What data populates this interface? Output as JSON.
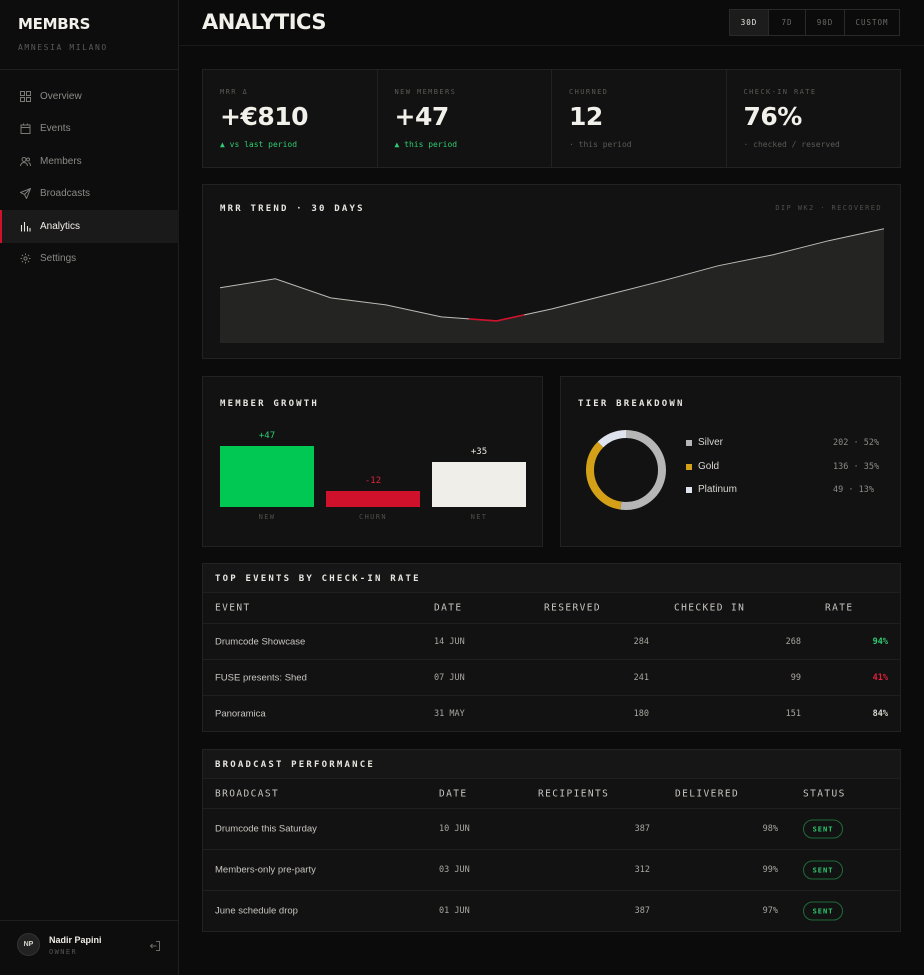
{
  "brand": {
    "name": "MEMBRS",
    "venue": "AMNESIA MILANO"
  },
  "nav": [
    {
      "label": "Overview",
      "icon": "grid-icon"
    },
    {
      "label": "Events",
      "icon": "calendar-icon"
    },
    {
      "label": "Members",
      "icon": "users-icon"
    },
    {
      "label": "Broadcasts",
      "icon": "send-icon"
    },
    {
      "label": "Analytics",
      "icon": "bar-chart-icon",
      "active": true
    },
    {
      "label": "Settings",
      "icon": "gear-icon"
    }
  ],
  "user": {
    "initials": "NP",
    "name": "Nadir Papini",
    "role": "OWNER"
  },
  "header": {
    "title": "ANALYTICS",
    "ranges": [
      "30D",
      "7D",
      "90D",
      "CUSTOM"
    ],
    "selected_range": "30D"
  },
  "kpis": [
    {
      "label": "MRR Δ",
      "value": "+€810",
      "sub": "▲ vs last period",
      "positive": true
    },
    {
      "label": "NEW MEMBERS",
      "value": "+47",
      "sub": "▲ this period",
      "positive": true
    },
    {
      "label": "CHURNED",
      "value": "12",
      "sub": "· this period",
      "positive": false
    },
    {
      "label": "CHECK-IN RATE",
      "value": "76%",
      "sub": "· checked / reserved",
      "positive": false
    }
  ],
  "mrr_trend": {
    "title": "MRR TREND · 30 DAYS",
    "note": "DIP WK2 · RECOVERED",
    "values": [
      0.55,
      0.64,
      0.45,
      0.38,
      0.26,
      0.22,
      0.34,
      0.48,
      0.62,
      0.77,
      0.88,
      1.02,
      1.14
    ],
    "dip_index": 5,
    "colors": {
      "line": "#bdbbb5",
      "fill": "#242422",
      "dip": "#d0112b"
    }
  },
  "member_growth": {
    "title": "MEMBER GROWTH",
    "bars": [
      {
        "label": "NEW",
        "value": 47,
        "display": "+47",
        "color": "#00c853",
        "label_color": "#2ecc71"
      },
      {
        "label": "CHURN",
        "value": -12,
        "display": "-12",
        "color": "#d0112b",
        "label_color": "#e0213b"
      },
      {
        "label": "NET",
        "value": 35,
        "display": "+35",
        "color": "#f0eee8",
        "label_color": "#e8e6e0"
      }
    ]
  },
  "tier_breakdown": {
    "title": "TIER BREAKDOWN",
    "tiers": [
      {
        "name": "Silver",
        "count": 202,
        "pct": 52,
        "detail": "202 · 52%",
        "color": "#b6b6b6"
      },
      {
        "name": "Gold",
        "count": 136,
        "pct": 35,
        "detail": "136 · 35%",
        "color": "#d4a017"
      },
      {
        "name": "Platinum",
        "count": 49,
        "pct": 13,
        "detail": "49 · 13%",
        "color": "#dfe3ee"
      }
    ]
  },
  "top_events": {
    "title": "TOP EVENTS BY CHECK-IN RATE",
    "columns": [
      "EVENT",
      "DATE",
      "RESERVED",
      "CHECKED IN",
      "RATE"
    ],
    "rows": [
      {
        "event": "Drumcode Showcase",
        "date": "14 JUN",
        "reserved": "284",
        "checked_in": "268",
        "rate": "94%",
        "rate_color": "#2ecc71"
      },
      {
        "event": "FUSE presents: Shed",
        "date": "07 JUN",
        "reserved": "241",
        "checked_in": "99",
        "rate": "41%",
        "rate_color": "#e0213b"
      },
      {
        "event": "Panoramica",
        "date": "31 MAY",
        "reserved": "180",
        "checked_in": "151",
        "rate": "84%",
        "rate_color": "#d8d6d0"
      }
    ]
  },
  "broadcasts": {
    "title": "BROADCAST PERFORMANCE",
    "columns": [
      "BROADCAST",
      "DATE",
      "RECIPIENTS",
      "DELIVERED",
      "STATUS"
    ],
    "rows": [
      {
        "name": "Drumcode this Saturday",
        "date": "10 JUN",
        "recipients": "387",
        "delivered": "98%",
        "status": "SENT"
      },
      {
        "name": "Members-only pre-party",
        "date": "03 JUN",
        "recipients": "312",
        "delivered": "99%",
        "status": "SENT"
      },
      {
        "name": "June schedule drop",
        "date": "01 JUN",
        "recipients": "387",
        "delivered": "97%",
        "status": "SENT"
      }
    ]
  }
}
